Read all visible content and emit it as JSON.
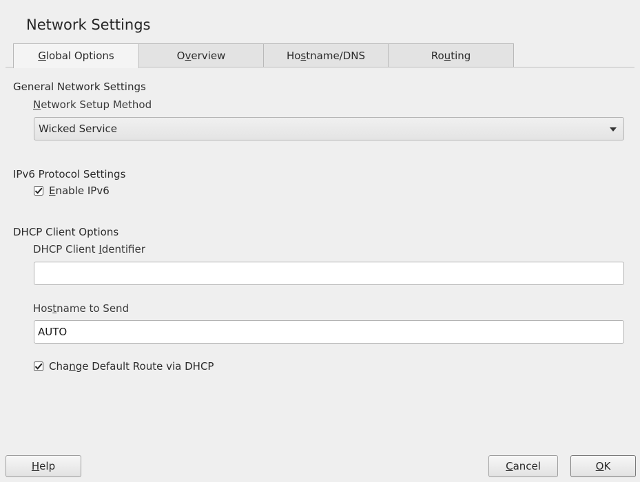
{
  "window": {
    "title": "Network Settings"
  },
  "tabs": [
    {
      "label_pre": "",
      "label_key": "G",
      "label_post": "lobal Options",
      "active": true
    },
    {
      "label_pre": "O",
      "label_key": "v",
      "label_post": "erview",
      "active": false
    },
    {
      "label_pre": "Ho",
      "label_key": "s",
      "label_post": "tname/DNS",
      "active": false
    },
    {
      "label_pre": "Ro",
      "label_key": "u",
      "label_post": "ting",
      "active": false
    }
  ],
  "general": {
    "section_title": "General Network Settings",
    "method_label_key": "N",
    "method_label_rest": "etwork Setup Method",
    "method_value": "Wicked Service"
  },
  "ipv6": {
    "section_title": "IPv6 Protocol Settings",
    "enable_label_key": "E",
    "enable_label_rest": "nable IPv6",
    "enabled": true
  },
  "dhcp": {
    "section_title": "DHCP Client Options",
    "identifier_label_pre": "DHCP Client ",
    "identifier_label_key": "I",
    "identifier_label_post": "dentifier",
    "identifier_value": "",
    "hostname_label_pre": "Hos",
    "hostname_label_key": "t",
    "hostname_label_post": "name to Send",
    "hostname_value": "AUTO",
    "route_label_pre": "Cha",
    "route_label_key": "n",
    "route_label_post": "ge Default Route via DHCP",
    "route_checked": true
  },
  "buttons": {
    "help_key": "H",
    "help_rest": "elp",
    "cancel_key": "C",
    "cancel_rest": "ancel",
    "ok_key": "O",
    "ok_rest": "K"
  },
  "icons": {
    "checkbox": "checkbox-checked-icon",
    "dropdown": "chevron-down-icon"
  }
}
